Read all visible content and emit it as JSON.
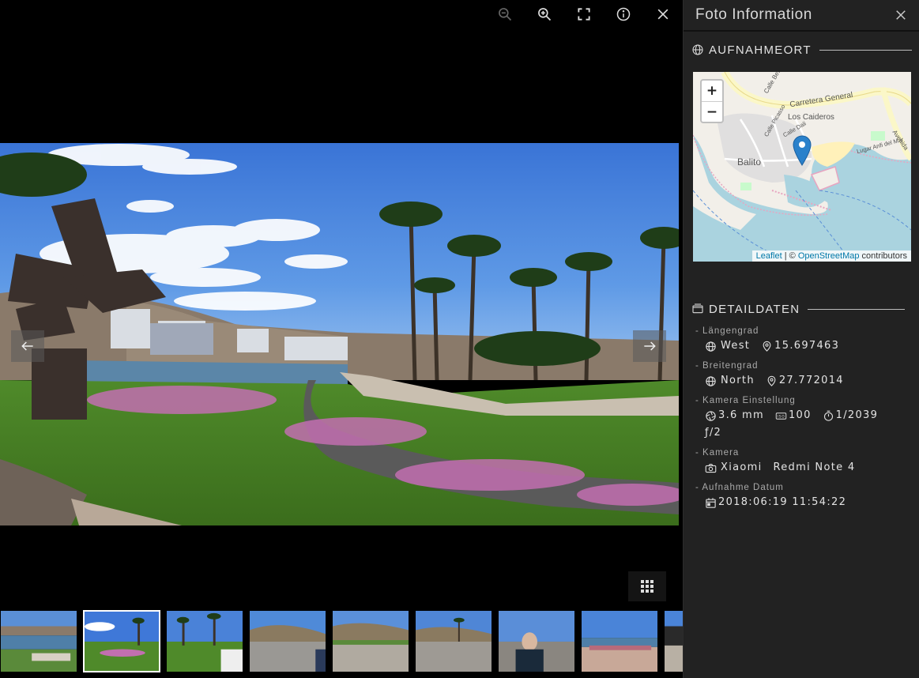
{
  "viewer": {
    "toolbar": [
      {
        "name": "zoom-out-icon",
        "enabled": false
      },
      {
        "name": "zoom-in-icon",
        "enabled": true
      },
      {
        "name": "fullscreen-icon",
        "enabled": true
      },
      {
        "name": "info-icon",
        "enabled": true
      },
      {
        "name": "close-icon",
        "enabled": true
      }
    ],
    "thumbnail_count": 9,
    "active_thumbnail": 1
  },
  "panel": {
    "title": "Foto Information",
    "location": {
      "heading": "AUFNAHMEORT",
      "map": {
        "zoom_in": "+",
        "zoom_out": "−",
        "labels": [
          "Carretera General",
          "Calle Besay",
          "Los Caideros",
          "Calle Picasso",
          "Calle Dali",
          "Balito",
          "Lugar Anfi del Mar",
          "Avenida"
        ],
        "attribution_leaflet": "Leaflet",
        "attribution_sep": " | © ",
        "attribution_osm": "OpenStreetMap",
        "attribution_tail": " contributors"
      }
    },
    "details": {
      "heading": "DETAILDATEN",
      "longitude": {
        "label": "- Längengrad",
        "hemisphere": "West",
        "value": "15.697463"
      },
      "latitude": {
        "label": "- Breitengrad",
        "hemisphere": "North",
        "value": "27.772014"
      },
      "camera_settings": {
        "label": "- Kamera Einstellung",
        "focal": "3.6 mm",
        "iso": "100",
        "shutter": "1/2039",
        "aperture": "ƒ/2"
      },
      "camera": {
        "label": "- Kamera",
        "make": "Xiaomi",
        "model": "Redmi Note 4"
      },
      "date": {
        "label": "- Aufnahme Datum",
        "value": "2018:06:19 11:54:22"
      }
    }
  },
  "colors": {
    "panel_bg": "#222222",
    "viewer_bg": "#000000",
    "marker": "#2a81cb"
  }
}
